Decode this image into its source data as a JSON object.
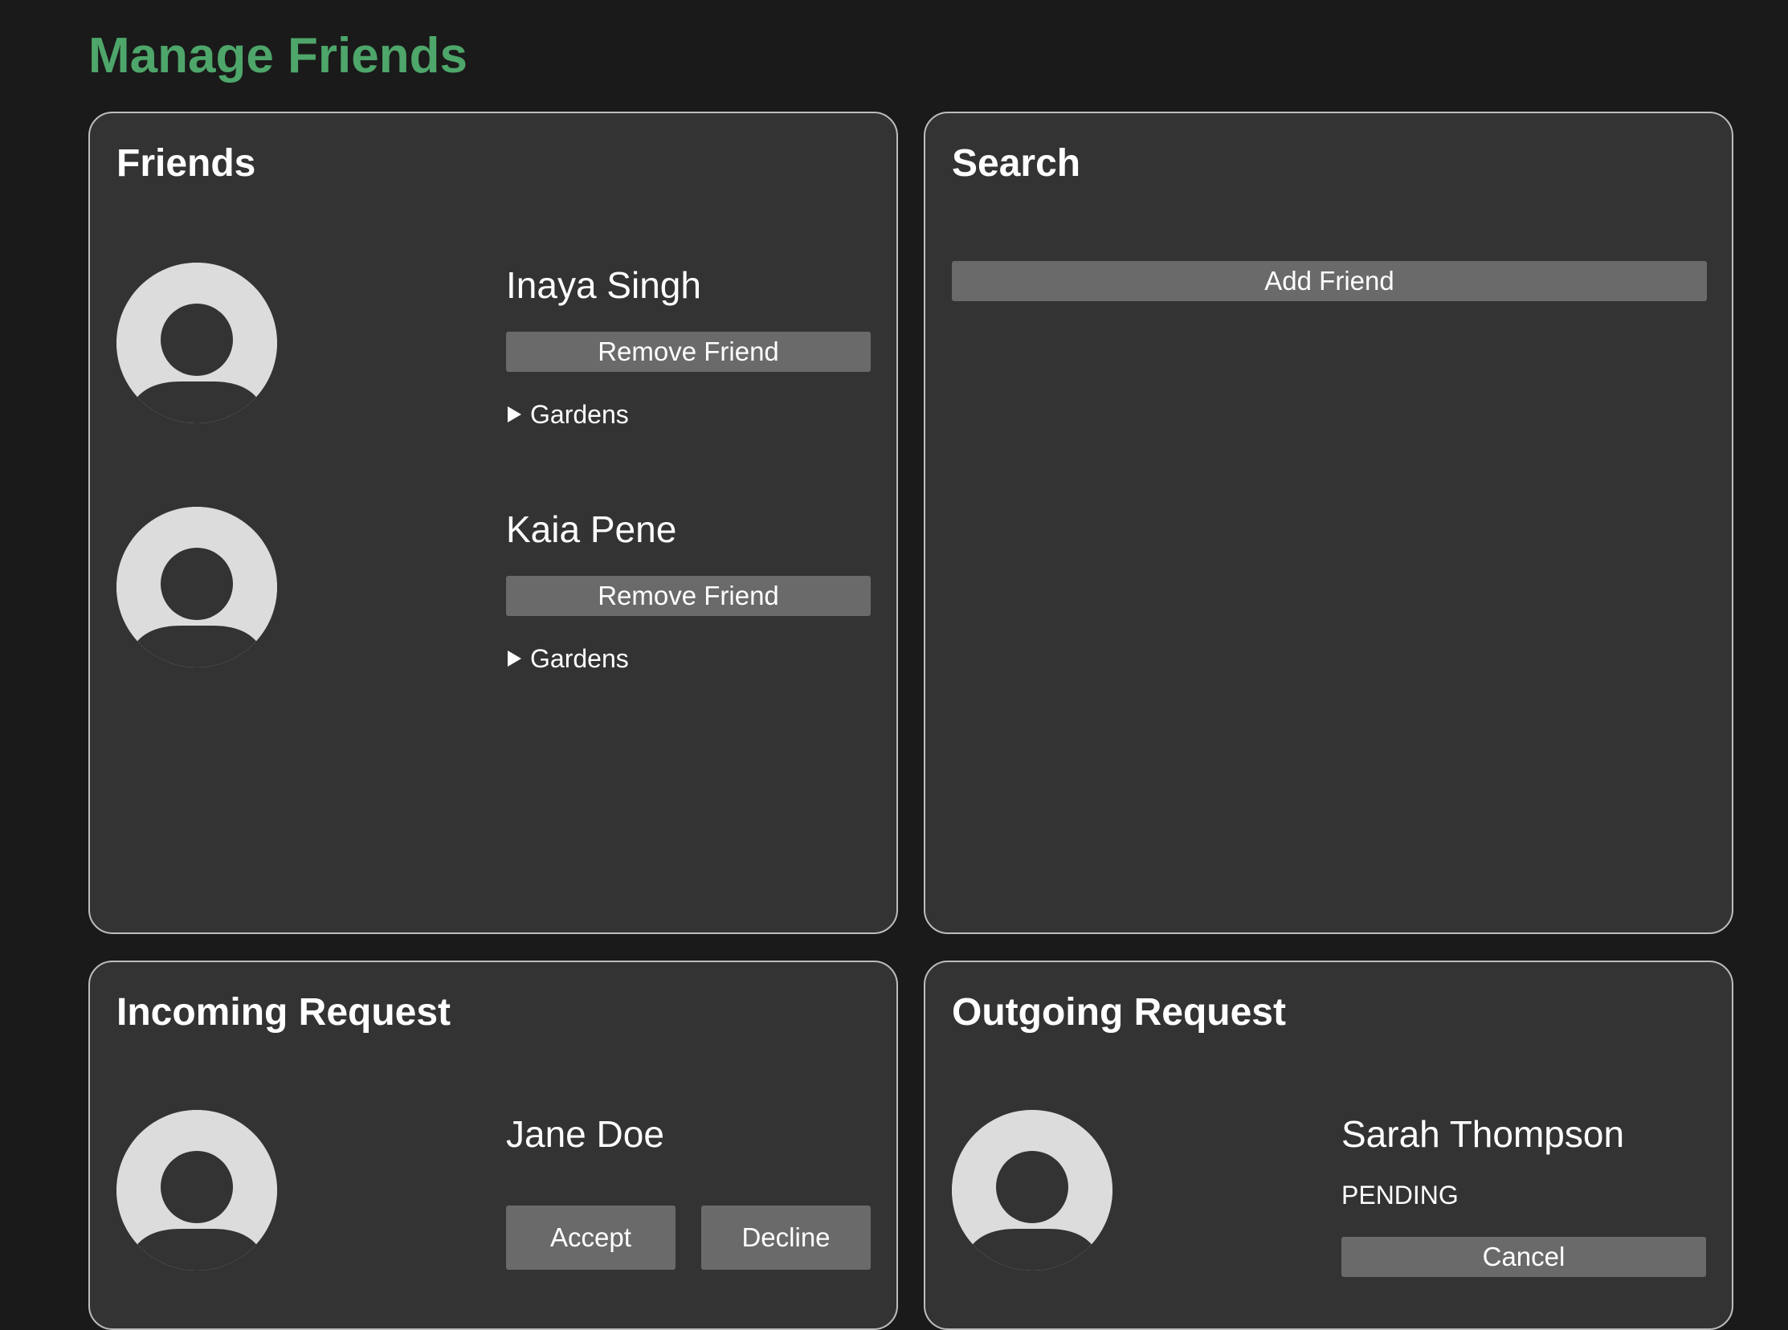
{
  "page": {
    "title": "Manage Friends",
    "accent_color": "#4ea66a",
    "background_color": "#1a1a1a",
    "panel_color": "#333333",
    "button_color": "#6a6a6a"
  },
  "friends_panel": {
    "title": "Friends",
    "friends": [
      {
        "name": "Inaya Singh",
        "remove_label": "Remove Friend",
        "gardens_label": "Gardens",
        "avatar_icon": "default-user-icon"
      },
      {
        "name": "Kaia Pene",
        "remove_label": "Remove Friend",
        "gardens_label": "Gardens",
        "avatar_icon": "default-user-icon"
      }
    ]
  },
  "search_panel": {
    "title": "Search",
    "add_friend_label": "Add Friend"
  },
  "incoming_panel": {
    "title": "Incoming Request",
    "requests": [
      {
        "name": "Jane Doe",
        "accept_label": "Accept",
        "decline_label": "Decline",
        "avatar_icon": "default-user-icon"
      }
    ]
  },
  "outgoing_panel": {
    "title": "Outgoing Request",
    "requests": [
      {
        "name": "Sarah Thompson",
        "status": "PENDING",
        "cancel_label": "Cancel",
        "avatar_icon": "default-user-icon"
      }
    ]
  }
}
